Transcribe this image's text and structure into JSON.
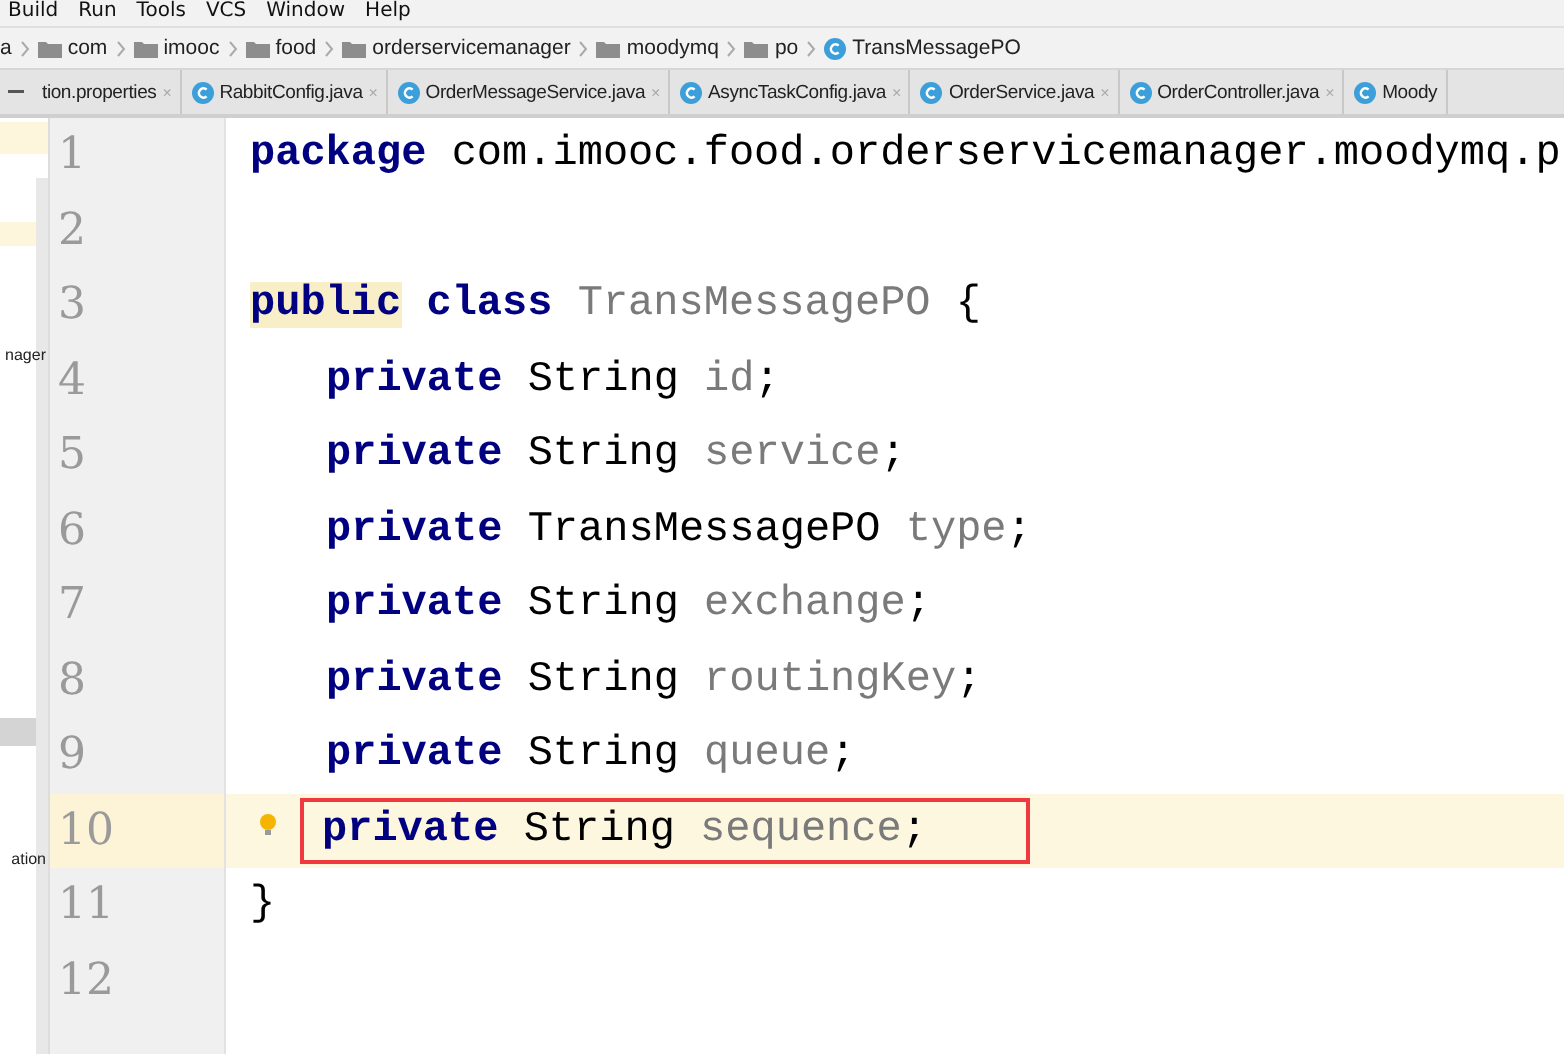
{
  "menu": [
    "Build",
    "Run",
    "Tools",
    "VCS",
    "Window",
    "Help"
  ],
  "breadcrumb": [
    {
      "label": "a",
      "kind": "none"
    },
    {
      "label": "com",
      "kind": "folder"
    },
    {
      "label": "imooc",
      "kind": "folder"
    },
    {
      "label": "food",
      "kind": "folder"
    },
    {
      "label": "orderservicemanager",
      "kind": "folder"
    },
    {
      "label": "moodymq",
      "kind": "folder"
    },
    {
      "label": "po",
      "kind": "folder"
    },
    {
      "label": "TransMessagePO",
      "kind": "class"
    }
  ],
  "tabs": [
    {
      "label": "tion.properties",
      "icon": false,
      "close": "×",
      "selected": false
    },
    {
      "label": "RabbitConfig.java",
      "icon": true,
      "close": "×",
      "selected": false
    },
    {
      "label": "OrderMessageService.java",
      "icon": true,
      "close": "×",
      "selected": false
    },
    {
      "label": "AsyncTaskConfig.java",
      "icon": true,
      "close": "×",
      "selected": false
    },
    {
      "label": "OrderService.java",
      "icon": true,
      "close": "×",
      "selected": false
    },
    {
      "label": "OrderController.java",
      "icon": true,
      "close": "×",
      "selected": false
    },
    {
      "label": "Moody",
      "icon": true,
      "selected": false
    }
  ],
  "sidebar": [
    "nager",
    "ation"
  ],
  "editor": {
    "lines": [
      {
        "number": "1",
        "indented": false,
        "current": false,
        "boxed": false,
        "bulb": false,
        "tokens": [
          {
            "text": "package ",
            "kind": "keyword"
          },
          {
            "text": "com.imooc.food.orderservicemanager.moodymq.p",
            "kind": "plain"
          }
        ]
      },
      {
        "number": "2",
        "current": false,
        "boxed": false,
        "bulb": false
      },
      {
        "number": "3",
        "indented": false,
        "current": false,
        "boxed": false,
        "bulb": false,
        "tokens": [
          {
            "text": "public",
            "kind": "keyword_marked"
          },
          {
            "text": " class ",
            "kind": "keyword"
          },
          {
            "text": "TransMessagePO",
            "kind": "name"
          },
          {
            "text": " {",
            "kind": "plain"
          }
        ]
      },
      {
        "number": "4",
        "indented": true,
        "current": false,
        "boxed": false,
        "bulb": false,
        "tokens": [
          {
            "text": "private ",
            "kind": "keyword"
          },
          {
            "text": "String ",
            "kind": "plain"
          },
          {
            "text": "id",
            "kind": "name"
          },
          {
            "text": ";",
            "kind": "plain"
          }
        ]
      },
      {
        "number": "5",
        "indented": true,
        "current": false,
        "boxed": false,
        "bulb": false,
        "tokens": [
          {
            "text": "private ",
            "kind": "keyword"
          },
          {
            "text": "String ",
            "kind": "plain"
          },
          {
            "text": "service",
            "kind": "name"
          },
          {
            "text": ";",
            "kind": "plain"
          }
        ]
      },
      {
        "number": "6",
        "indented": true,
        "current": false,
        "boxed": false,
        "bulb": false,
        "tokens": [
          {
            "text": "private ",
            "kind": "keyword"
          },
          {
            "text": "TransMessagePO ",
            "kind": "plain"
          },
          {
            "text": "type",
            "kind": "name"
          },
          {
            "text": ";",
            "kind": "plain"
          }
        ]
      },
      {
        "number": "7",
        "indented": true,
        "current": false,
        "boxed": false,
        "bulb": false,
        "tokens": [
          {
            "text": "private ",
            "kind": "keyword"
          },
          {
            "text": "String ",
            "kind": "plain"
          },
          {
            "text": "exchange",
            "kind": "name"
          },
          {
            "text": ";",
            "kind": "plain"
          }
        ]
      },
      {
        "number": "8",
        "indented": true,
        "current": false,
        "boxed": false,
        "bulb": false,
        "tokens": [
          {
            "text": "private ",
            "kind": "keyword"
          },
          {
            "text": "String ",
            "kind": "plain"
          },
          {
            "text": "routingKey",
            "kind": "name"
          },
          {
            "text": ";",
            "kind": "plain"
          }
        ]
      },
      {
        "number": "9",
        "indented": true,
        "current": false,
        "boxed": false,
        "bulb": false,
        "tokens": [
          {
            "text": "private ",
            "kind": "keyword"
          },
          {
            "text": "String ",
            "kind": "plain"
          },
          {
            "text": "queue",
            "kind": "name"
          },
          {
            "text": ";",
            "kind": "plain"
          }
        ]
      },
      {
        "number": "10",
        "indented": true,
        "current": true,
        "boxed": true,
        "bulb": true,
        "tokens": [
          {
            "text": "private ",
            "kind": "keyword"
          },
          {
            "text": "String ",
            "kind": "plain"
          },
          {
            "text": "sequence",
            "kind": "name"
          },
          {
            "text": ";",
            "kind": "plain"
          }
        ]
      },
      {
        "number": "11",
        "indented": false,
        "current": false,
        "boxed": false,
        "bulb": false,
        "tokens": [
          {
            "text": "}",
            "kind": "plain"
          }
        ]
      },
      {
        "number": "12",
        "current": false,
        "boxed": false,
        "bulb": false
      }
    ]
  }
}
